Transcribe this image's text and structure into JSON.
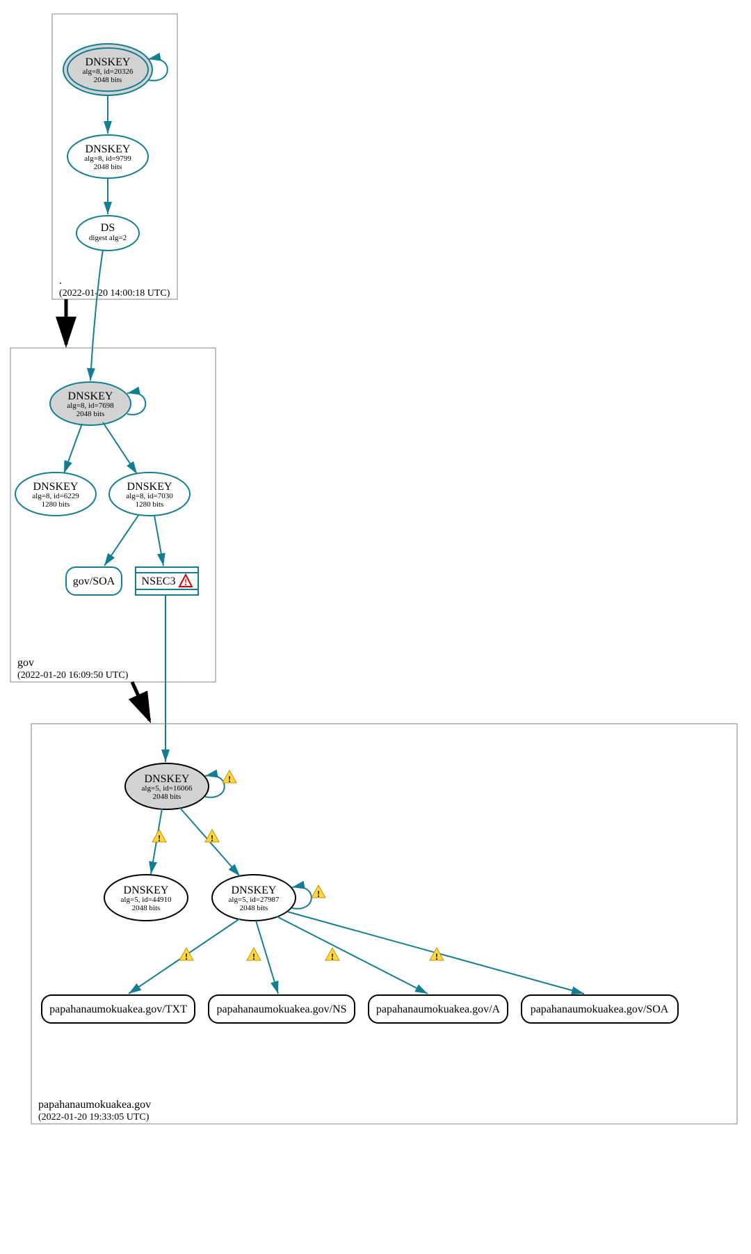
{
  "zones": {
    "root": {
      "label": ".",
      "timestamp": "(2022-01-20 14:00:18 UTC)"
    },
    "gov": {
      "label": "gov",
      "timestamp": "(2022-01-20 16:09:50 UTC)"
    },
    "papa": {
      "label": "papahanaumokuakea.gov",
      "timestamp": "(2022-01-20 19:33:05 UTC)"
    }
  },
  "nodes": {
    "root_ksk": {
      "title": "DNSKEY",
      "line1": "alg=8, id=20326",
      "line2": "2048 bits"
    },
    "root_zsk": {
      "title": "DNSKEY",
      "line1": "alg=8, id=9799",
      "line2": "2048 bits"
    },
    "root_ds": {
      "title": "DS",
      "line1": "digest alg=2",
      "line2": ""
    },
    "gov_ksk": {
      "title": "DNSKEY",
      "line1": "alg=8, id=7698",
      "line2": "2048 bits"
    },
    "gov_zsk1": {
      "title": "DNSKEY",
      "line1": "alg=8, id=6229",
      "line2": "1280 bits"
    },
    "gov_zsk2": {
      "title": "DNSKEY",
      "line1": "alg=8, id=7030",
      "line2": "1280 bits"
    },
    "gov_soa": {
      "title": "gov/SOA"
    },
    "gov_nsec3": {
      "title": "NSEC3"
    },
    "papa_ksk": {
      "title": "DNSKEY",
      "line1": "alg=5, id=16066",
      "line2": "2048 bits"
    },
    "papa_zsk1": {
      "title": "DNSKEY",
      "line1": "alg=5, id=44910",
      "line2": "2048 bits"
    },
    "papa_zsk2": {
      "title": "DNSKEY",
      "line1": "alg=5, id=27987",
      "line2": "2048 bits"
    },
    "papa_txt": {
      "title": "papahanaumokuakea.gov/TXT"
    },
    "papa_ns": {
      "title": "papahanaumokuakea.gov/NS"
    },
    "papa_a": {
      "title": "papahanaumokuakea.gov/A"
    },
    "papa_soa": {
      "title": "papahanaumokuakea.gov/SOA"
    }
  }
}
